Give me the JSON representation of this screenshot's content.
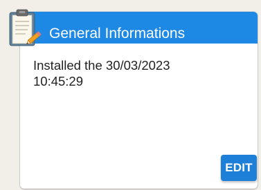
{
  "card": {
    "title": "General Informations",
    "body_line1": "Installed the 30/03/2023",
    "body_line2": "10:45:29",
    "edit_label": "EDIT",
    "header_icon": "clipboard-pencil-icon"
  },
  "colors": {
    "header_blue": "#1e88e5",
    "button_blue": "#1e7fd8",
    "background": "#f2efe9"
  }
}
